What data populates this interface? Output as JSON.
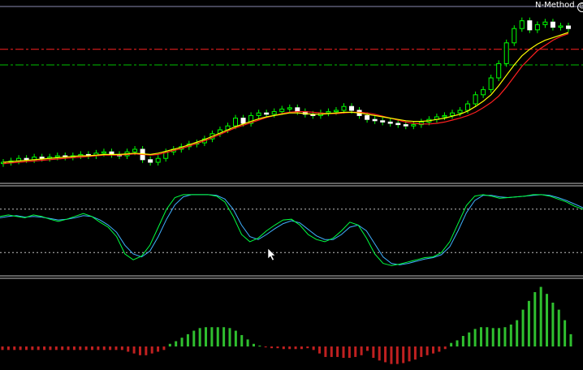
{
  "indicator_label": "N-Method",
  "indicator_icon": "smiley-icon",
  "colors": {
    "background": "#000000",
    "bull_candle": "#00ff00",
    "bear_candle": "#ffffff",
    "wick": "#00ff00",
    "ma_fast": "#ffff00",
    "ma_slow": "#ff2020",
    "level_red": "#ff2020",
    "level_green": "#00c000",
    "level_top": "#8a8ab0",
    "stoch_main": "#00ff40",
    "stoch_signal": "#40b0ff",
    "stoch_levels": "#c0c0c0",
    "hist_pos": "#2fbf2f",
    "hist_neg": "#c02020",
    "separator": "#c0c0c0"
  },
  "chart_data": [
    {
      "type": "candlestick",
      "closes": [
        1.0,
        1.1,
        1.3,
        1.2,
        1.4,
        1.3,
        1.4,
        1.5,
        1.4,
        1.5,
        1.6,
        1.5,
        1.7,
        1.8,
        1.6,
        1.5,
        1.8,
        2.0,
        1.2,
        1.0,
        1.3,
        1.8,
        2.0,
        2.2,
        2.4,
        2.5,
        2.8,
        3.2,
        3.5,
        3.8,
        4.4,
        4.0,
        4.6,
        4.8,
        4.7,
        4.9,
        5.1,
        5.2,
        4.9,
        4.7,
        4.6,
        4.8,
        4.9,
        5.0,
        5.3,
        5.0,
        4.6,
        4.3,
        4.2,
        4.1,
        4.0,
        3.9,
        3.8,
        3.9,
        4.1,
        4.3,
        4.5,
        4.6,
        4.8,
        5.0,
        5.5,
        6.2,
        6.6,
        7.5,
        8.6,
        10.2,
        11.3,
        11.9,
        11.2,
        11.6,
        11.8,
        11.4,
        11.5,
        11.3
      ],
      "ma_fast": [
        1.0,
        1.05,
        1.1,
        1.15,
        1.2,
        1.25,
        1.3,
        1.35,
        1.4,
        1.45,
        1.5,
        1.5,
        1.55,
        1.6,
        1.6,
        1.6,
        1.65,
        1.7,
        1.65,
        1.6,
        1.7,
        1.85,
        2.0,
        2.15,
        2.35,
        2.55,
        2.75,
        3.0,
        3.25,
        3.5,
        3.75,
        3.95,
        4.15,
        4.35,
        4.5,
        4.6,
        4.7,
        4.8,
        4.8,
        4.75,
        4.7,
        4.7,
        4.75,
        4.8,
        4.85,
        4.85,
        4.8,
        4.7,
        4.6,
        4.5,
        4.4,
        4.3,
        4.2,
        4.15,
        4.15,
        4.2,
        4.3,
        4.4,
        4.55,
        4.7,
        4.95,
        5.3,
        5.7,
        6.2,
        6.9,
        7.7,
        8.5,
        9.2,
        9.7,
        10.1,
        10.4,
        10.6,
        10.8,
        11.0
      ],
      "ma_slow": [
        0.9,
        0.95,
        1.0,
        1.05,
        1.1,
        1.15,
        1.2,
        1.25,
        1.3,
        1.35,
        1.4,
        1.45,
        1.5,
        1.55,
        1.55,
        1.55,
        1.6,
        1.65,
        1.6,
        1.55,
        1.6,
        1.75,
        1.9,
        2.05,
        2.25,
        2.45,
        2.65,
        2.9,
        3.15,
        3.4,
        3.65,
        3.85,
        4.05,
        4.25,
        4.45,
        4.6,
        4.75,
        4.85,
        4.9,
        4.9,
        4.85,
        4.8,
        4.75,
        4.75,
        4.8,
        4.85,
        4.85,
        4.8,
        4.7,
        4.55,
        4.4,
        4.25,
        4.1,
        4.0,
        3.95,
        3.95,
        4.0,
        4.1,
        4.25,
        4.4,
        4.6,
        4.85,
        5.2,
        5.6,
        6.1,
        6.8,
        7.6,
        8.4,
        9.0,
        9.6,
        10.0,
        10.4,
        10.7,
        10.9
      ],
      "levels": [
        {
          "name": "top",
          "value": 13.0
        },
        {
          "name": "red",
          "value": 9.7
        },
        {
          "name": "green",
          "value": 8.5
        }
      ],
      "ylim": [
        -0.5,
        13.5
      ]
    },
    {
      "type": "line",
      "main": [
        70,
        72,
        70,
        68,
        72,
        70,
        66,
        63,
        66,
        70,
        74,
        70,
        62,
        55,
        42,
        18,
        10,
        15,
        30,
        55,
        80,
        96,
        100,
        100,
        100,
        100,
        98,
        90,
        70,
        45,
        35,
        40,
        50,
        58,
        65,
        66,
        58,
        45,
        38,
        35,
        40,
        50,
        62,
        58,
        40,
        18,
        5,
        2,
        4,
        7,
        10,
        13,
        14,
        20,
        35,
        60,
        85,
        98,
        100,
        98,
        95,
        96,
        97,
        98,
        100,
        100,
        98,
        94,
        90,
        84,
        80
      ],
      "signal": [
        68,
        70,
        71,
        69,
        70,
        69,
        67,
        65,
        66,
        68,
        71,
        70,
        65,
        58,
        48,
        30,
        18,
        14,
        22,
        42,
        66,
        86,
        97,
        100,
        100,
        100,
        99,
        94,
        80,
        58,
        42,
        38,
        45,
        53,
        60,
        64,
        61,
        52,
        43,
        38,
        38,
        45,
        55,
        58,
        50,
        32,
        14,
        5,
        3,
        5,
        8,
        11,
        13,
        17,
        28,
        50,
        75,
        92,
        99,
        99,
        97,
        96,
        97,
        98,
        99,
        100,
        99,
        96,
        92,
        87,
        82
      ],
      "levels": [
        80,
        20
      ],
      "ylim": [
        -10,
        110
      ]
    },
    {
      "type": "bar",
      "values": [
        -0.4,
        -0.4,
        -0.4,
        -0.4,
        -0.4,
        -0.4,
        -0.4,
        -0.4,
        -0.4,
        -0.4,
        -0.4,
        -0.4,
        -0.4,
        -0.4,
        -0.4,
        -0.4,
        -0.4,
        -0.4,
        -0.4,
        -0.4,
        -0.4,
        -0.6,
        -0.8,
        -1.0,
        -1.0,
        -0.8,
        -0.6,
        -0.4,
        0.3,
        0.6,
        1.0,
        1.4,
        1.8,
        2.1,
        2.2,
        2.2,
        2.2,
        2.2,
        2.1,
        1.8,
        1.3,
        0.8,
        0.3,
        0.1,
        -0.1,
        -0.2,
        -0.2,
        -0.3,
        -0.3,
        -0.3,
        -0.3,
        -0.2,
        -0.4,
        -0.8,
        -1.2,
        -1.2,
        -1.2,
        -1.3,
        -1.3,
        -1.2,
        -1.0,
        -0.5,
        -1.3,
        -1.6,
        -1.8,
        -2.0,
        -2.0,
        -1.9,
        -1.7,
        -1.5,
        -1.2,
        -1.0,
        -0.8,
        -0.6,
        -0.3,
        0.4,
        0.7,
        1.2,
        1.6,
        2.0,
        2.2,
        2.2,
        2.1,
        2.1,
        2.2,
        2.5,
        3.0,
        4.2,
        5.2,
        6.2,
        6.8,
        6.0,
        5.0,
        4.2,
        3.0,
        1.4
      ],
      "ylim": [
        -2.5,
        7.5
      ]
    }
  ]
}
